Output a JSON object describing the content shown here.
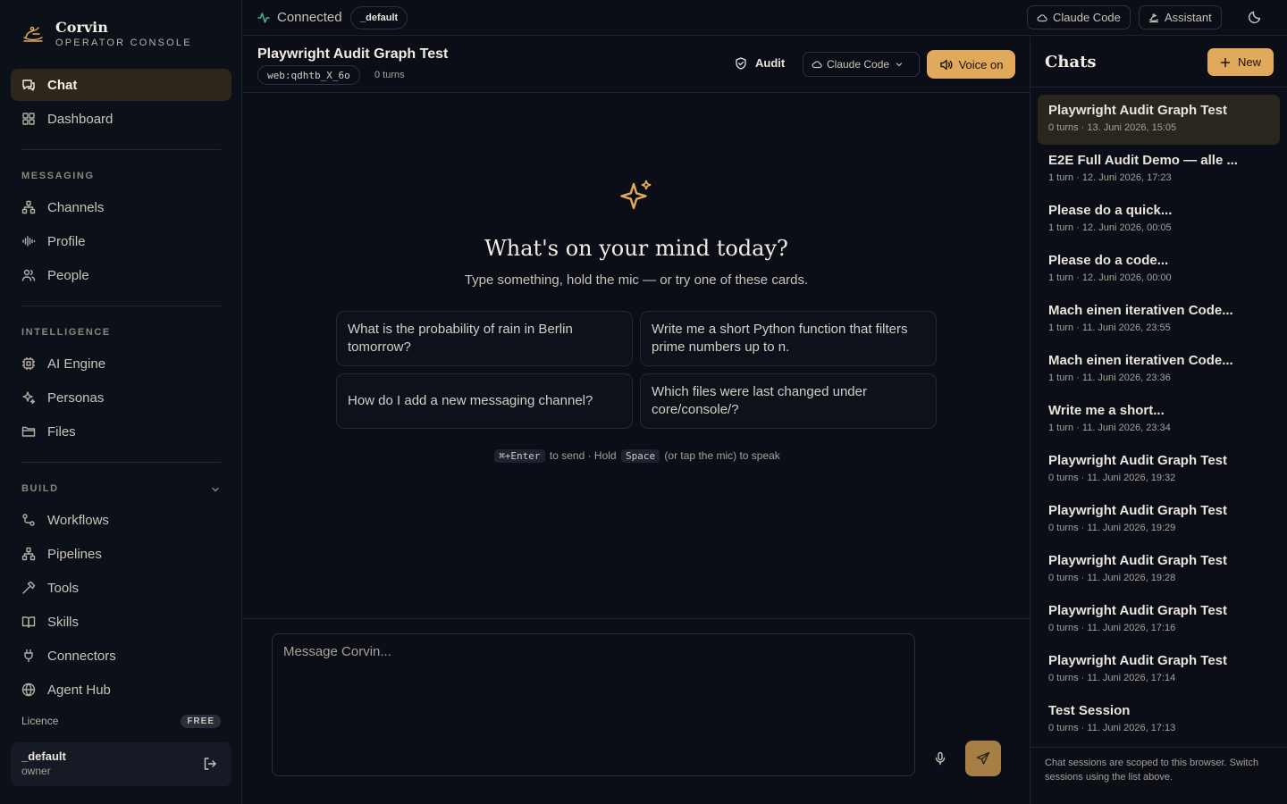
{
  "brand": {
    "title": "Corvin",
    "subtitle": "OPERATOR CONSOLE"
  },
  "nav": {
    "primary": [
      {
        "label": "Chat",
        "icon": "chat-icon",
        "active": true
      },
      {
        "label": "Dashboard",
        "icon": "dashboard-icon"
      }
    ],
    "sections": [
      {
        "title": "MESSAGING",
        "items": [
          {
            "label": "Channels",
            "icon": "channels-icon"
          },
          {
            "label": "Profile",
            "icon": "profile-icon"
          },
          {
            "label": "People",
            "icon": "people-icon"
          }
        ]
      },
      {
        "title": "INTELLIGENCE",
        "items": [
          {
            "label": "AI Engine",
            "icon": "ai-engine-icon"
          },
          {
            "label": "Personas",
            "icon": "personas-icon"
          },
          {
            "label": "Files",
            "icon": "files-icon"
          }
        ]
      },
      {
        "title": "BUILD",
        "items": [
          {
            "label": "Workflows",
            "icon": "workflows-icon"
          },
          {
            "label": "Pipelines",
            "icon": "pipelines-icon"
          },
          {
            "label": "Tools",
            "icon": "tools-icon"
          },
          {
            "label": "Skills",
            "icon": "skills-icon"
          },
          {
            "label": "Connectors",
            "icon": "connectors-icon"
          },
          {
            "label": "Agent Hub",
            "icon": "agent-hub-icon"
          }
        ]
      }
    ]
  },
  "licence": {
    "label": "Licence",
    "badge": "FREE"
  },
  "user": {
    "name": "_default",
    "role": "owner"
  },
  "topbar": {
    "status": "Connected",
    "workspace": "_default",
    "engine_label": "Claude Code",
    "assistant_label": "Assistant"
  },
  "chat": {
    "title": "Playwright Audit Graph Test",
    "session_id": "web:qdhtb_X_6o",
    "turns": "0 turns",
    "audit_label": "Audit",
    "model": "Claude Code",
    "voice_label": "Voice on"
  },
  "empty_state": {
    "headline": "What's on your mind today?",
    "subline": "Type something, hold the mic — or try one of these cards.",
    "cards": [
      "What is the probability of rain in Berlin tomorrow?",
      "Write me a short Python function that filters prime numbers up to n.",
      "How do I add a new messaging channel?",
      "Which files were last changed under core/console/?"
    ],
    "hint": {
      "key1": "⌘+Enter",
      "text1": "to send · Hold",
      "key2": "Space",
      "text2": "(or tap the mic) to speak"
    }
  },
  "composer": {
    "placeholder": "Message Corvin..."
  },
  "chats": {
    "title": "Chats",
    "new_label": "New",
    "items": [
      {
        "title": "Playwright Audit Graph Test",
        "meta": "0 turns  ·  13. Juni 2026, 15:05",
        "active": true
      },
      {
        "title": "E2E Full Audit Demo — alle ...",
        "meta": "1 turn  ·  12. Juni 2026, 17:23"
      },
      {
        "title": "Please do a quick...",
        "meta": "1 turn  ·  12. Juni 2026, 00:05"
      },
      {
        "title": "Please do a code...",
        "meta": "1 turn  ·  12. Juni 2026, 00:00"
      },
      {
        "title": "Mach einen iterativen Code...",
        "meta": "1 turn  ·  11. Juni 2026, 23:55"
      },
      {
        "title": "Mach einen iterativen Code...",
        "meta": "1 turn  ·  11. Juni 2026, 23:36"
      },
      {
        "title": "Write me a short...",
        "meta": "1 turn  ·  11. Juni 2026, 23:34"
      },
      {
        "title": "Playwright Audit Graph Test",
        "meta": "0 turns  ·  11. Juni 2026, 19:32"
      },
      {
        "title": "Playwright Audit Graph Test",
        "meta": "0 turns  ·  11. Juni 2026, 19:29"
      },
      {
        "title": "Playwright Audit Graph Test",
        "meta": "0 turns  ·  11. Juni 2026, 19:28"
      },
      {
        "title": "Playwright Audit Graph Test",
        "meta": "0 turns  ·  11. Juni 2026, 17:16"
      },
      {
        "title": "Playwright Audit Graph Test",
        "meta": "0 turns  ·  11. Juni 2026, 17:14"
      },
      {
        "title": "Test Session",
        "meta": "0 turns  ·  11. Juni 2026, 17:13"
      }
    ],
    "footer": "Chat sessions are scoped to this browser. Switch sessions using the list above."
  },
  "colors": {
    "accent": "#e0a95c",
    "background": "#0b0e17",
    "status_ok": "#3fb98a",
    "active_item": "#2c261d"
  }
}
